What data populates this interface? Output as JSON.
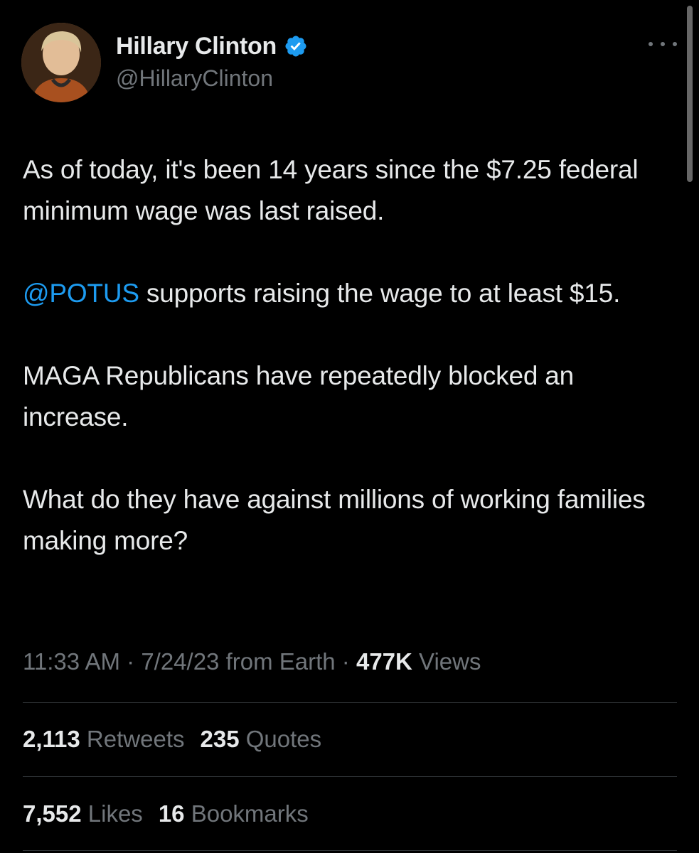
{
  "author": {
    "display_name": "Hillary Clinton",
    "handle": "@HillaryClinton",
    "verified": true,
    "verified_color": "#1d9bf0"
  },
  "tweet": {
    "paragraph_1": "As of today, it's been 14 years since the $7.25 federal minimum wage was last raised.",
    "paragraph_2_mention": "@POTUS",
    "paragraph_2_rest": " supports raising the wage to at least $15.",
    "paragraph_3": "MAGA Republicans have repeatedly blocked an increase.",
    "paragraph_4": "What do they have against millions of working families making more?"
  },
  "meta": {
    "time": "11:33 AM",
    "sep1": " · ",
    "date_source": "7/24/23 from Earth",
    "sep2": " · ",
    "views_count": "477K",
    "views_label": " Views"
  },
  "stats": {
    "retweets_count": "2,113",
    "retweets_label": " Retweets",
    "quotes_count": "235",
    "quotes_label": " Quotes",
    "likes_count": "7,552",
    "likes_label": " Likes",
    "bookmarks_count": "16",
    "bookmarks_label": " Bookmarks"
  },
  "colors": {
    "background": "#000000",
    "text_primary": "#e7e9ea",
    "text_secondary": "#71767b",
    "link": "#1d9bf0",
    "divider": "#2f3336"
  },
  "icons": {
    "verified": "verified-badge-icon",
    "more": "more-horizontal-icon"
  }
}
